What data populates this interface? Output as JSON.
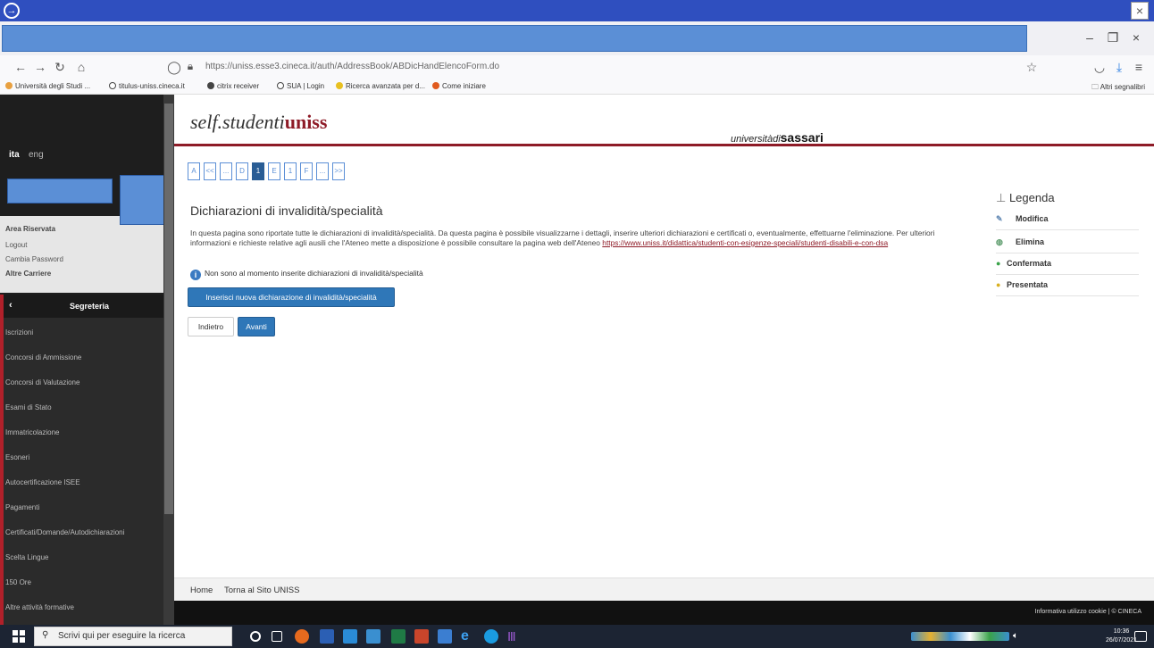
{
  "window": {
    "close_glyph": "×"
  },
  "browser": {
    "url": "https://uniss.esse3.cineca.it/auth/AddressBook/ABDicHandElencoForm.do",
    "bookmarks": [
      {
        "label": "Università degli Studi ...",
        "color": "#e8a040"
      },
      {
        "label": "titulus-uniss.cineca.it",
        "color": "#444444"
      },
      {
        "label": "citrix receiver",
        "color": "#444444"
      },
      {
        "label": "SUA | Login",
        "color": "#444444"
      },
      {
        "label": "Ricerca avanzata per d...",
        "color": "#e8c020"
      },
      {
        "label": "Come iniziare",
        "color": "#e05a1e"
      }
    ],
    "other_bookmarks": "Altri segnalibri"
  },
  "sidebar": {
    "lang_active": "ita",
    "lang_other": "eng",
    "area": {
      "title": "Area Riservata",
      "logout": "Logout",
      "change_password": "Cambia Password",
      "other_careers": "Altre Carriere"
    },
    "section_title": "Segreteria",
    "items": [
      "Iscrizioni",
      "Concorsi di Ammissione",
      "Concorsi di Valutazione",
      "Esami di Stato",
      "Immatricolazione",
      "Esoneri",
      "Autocertificazione ISEE",
      "Pagamenti",
      "Certificati/Domande/Autodichiarazioni",
      "Scelta Lingue",
      "150 Ore",
      "Altre attività formative"
    ]
  },
  "header": {
    "brand_prefix": "self.studenti",
    "brand_suffix": "uniss",
    "uni_prefix": "universitàdi",
    "uni_name": "sassari"
  },
  "pagination": [
    "A",
    "<<",
    "...",
    "D",
    "1",
    "E",
    "1",
    "F",
    "...",
    ">>"
  ],
  "main": {
    "title": "Dichiarazioni di invalidità/specialità",
    "intro": "In questa pagina sono riportate tutte le dichiarazioni di invalidità/specialità. Da questa pagina è possibile visualizzarne i dettagli, inserire ulteriori dichiarazioni e certificati o, eventualmente, effettuarne l'eliminazione. Per ulteriori informazioni e richieste relative agli ausili che l'Ateneo mette a disposizione è possibile consultare la pagina web dell'Ateneo ",
    "intro_link": "https://www.uniss.it/didattica/studenti-con-esigenze-speciali/studenti-disabili-e-con-dsa",
    "info": "Non sono al momento inserite dichiarazioni di invalidità/specialità",
    "btn_new": "Inserisci nuova dichiarazione di invalidità/specialità",
    "btn_back": "Indietro",
    "btn_next": "Avanti"
  },
  "legend": {
    "title": "Legenda",
    "items": [
      "Modifica",
      "Elimina",
      "Confermata",
      "Presentata"
    ]
  },
  "footer": {
    "home": "Home",
    "site": "Torna al Sito UNISS",
    "cookie": "Informativa utilizzo cookie | © CINECA"
  },
  "taskbar": {
    "search_placeholder": "Scrivi qui per eseguire la ricerca",
    "time": "10:36",
    "date": "26/07/2021"
  }
}
